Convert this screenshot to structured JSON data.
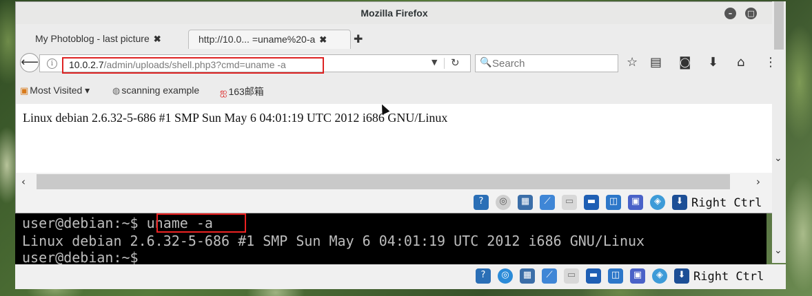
{
  "firefox": {
    "title": "Mozilla Firefox",
    "tabs": [
      {
        "label": "My Photoblog - last picture"
      },
      {
        "label": "http://10.0... =uname%20-a"
      }
    ],
    "url_host": "10.0.2.7",
    "url_path": "/admin/uploads/shell.php3?cmd=uname -a",
    "search_placeholder": "Search",
    "bookmarks": [
      "Most Visited ▾",
      "scanning example",
      "163邮箱"
    ],
    "page_output": "Linux debian 2.6.32-5-686 #1 SMP Sun May 6 04:01:19 UTC 2012 i686 GNU/Linux"
  },
  "vm_status": {
    "host_key_label": "Right Ctrl",
    "icons": [
      "help-icon",
      "optical-disk-icon",
      "network-icon",
      "usb-icon",
      "shared-folder-icon",
      "display-icon",
      "video-capture-icon",
      "cpu-icon",
      "mouse-integration-icon",
      "keyboard-arrow-icon"
    ]
  },
  "terminal": {
    "line1_prompt": "user@debian:~$",
    "line1_cmd": "uname -a",
    "line2": "Linux debian 2.6.32-5-686 #1 SMP Sun May 6 04:01:19 UTC 2012 i686 GNU/Linux",
    "line3_prompt": "user@debian:~$ _"
  },
  "colors": {
    "highlight": "#dd2222",
    "terminal_bg": "#000000",
    "terminal_text": "#bdbdbd"
  }
}
